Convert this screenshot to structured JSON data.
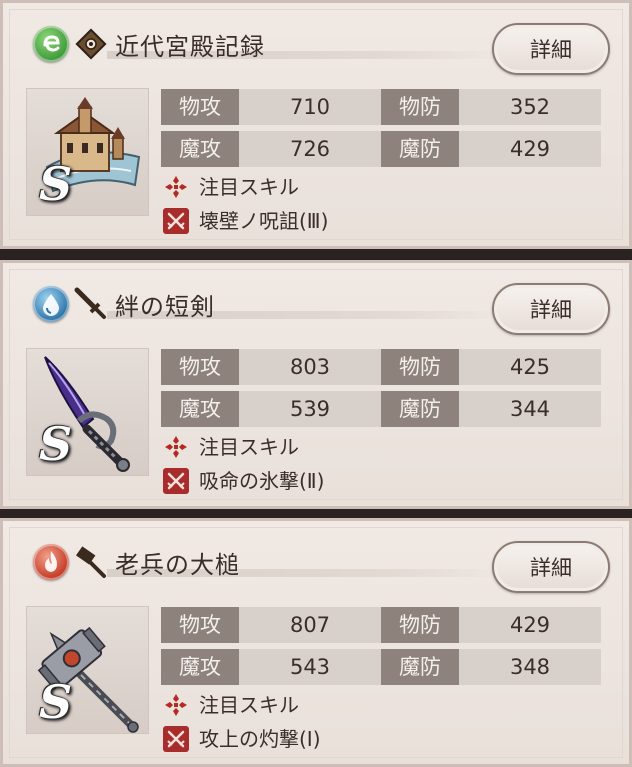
{
  "weapons": [
    {
      "name": "近代宮殿記録",
      "element": "wind",
      "element_color": "#3e9a3a",
      "weapon_type": "tome",
      "rank": "S",
      "detail_label": "詳細",
      "stats": [
        {
          "label": "物攻",
          "value": "710"
        },
        {
          "label": "物防",
          "value": "352"
        },
        {
          "label": "魔攻",
          "value": "726"
        },
        {
          "label": "魔防",
          "value": "429"
        }
      ],
      "featured_skill_label": "注目スキル",
      "skill_name": "壊壁ノ呪詛(Ⅲ)"
    },
    {
      "name": "絆の短剣",
      "element": "water",
      "element_color": "#2c74a8",
      "weapon_type": "dagger",
      "rank": "S",
      "detail_label": "詳細",
      "stats": [
        {
          "label": "物攻",
          "value": "803"
        },
        {
          "label": "物防",
          "value": "425"
        },
        {
          "label": "魔攻",
          "value": "539"
        },
        {
          "label": "魔防",
          "value": "344"
        }
      ],
      "featured_skill_label": "注目スキル",
      "skill_name": "吸命の氷撃(Ⅱ)"
    },
    {
      "name": "老兵の大槌",
      "element": "fire",
      "element_color": "#c43a25",
      "weapon_type": "hammer",
      "rank": "S",
      "detail_label": "詳細",
      "stats": [
        {
          "label": "物攻",
          "value": "807"
        },
        {
          "label": "物防",
          "value": "429"
        },
        {
          "label": "魔攻",
          "value": "543"
        },
        {
          "label": "魔防",
          "value": "348"
        }
      ],
      "featured_skill_label": "注目スキル",
      "skill_name": "攻上の灼撃(Ⅰ)"
    }
  ]
}
